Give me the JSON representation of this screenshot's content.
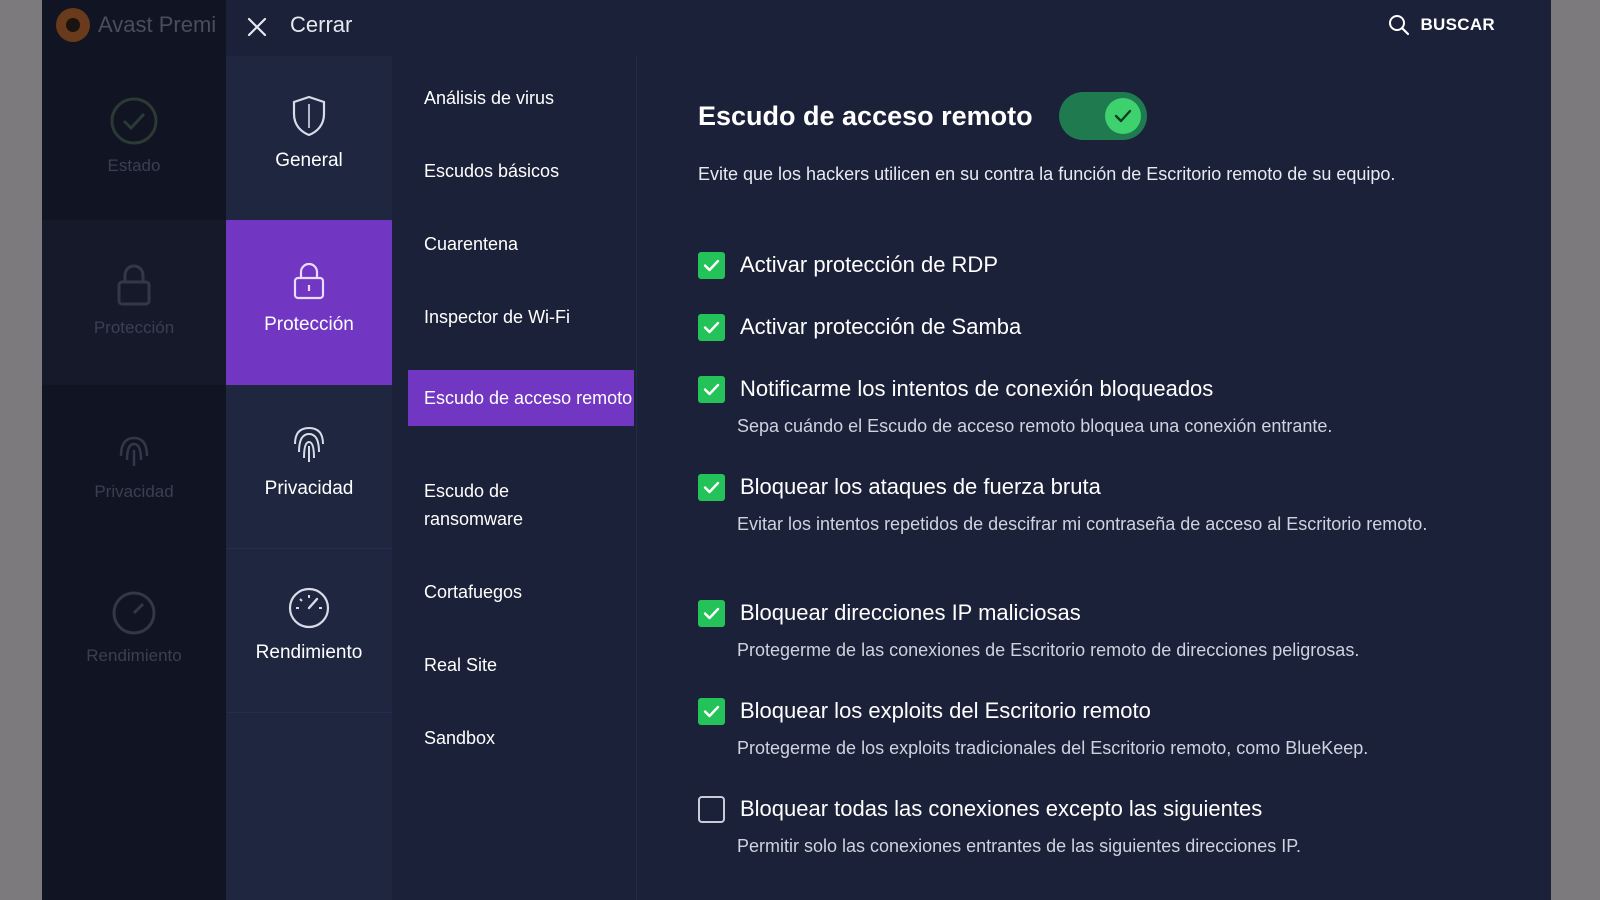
{
  "background_app": {
    "title": "Avast Premi",
    "nav": [
      "Estado",
      "Protección",
      "Privacidad",
      "Rendimiento"
    ]
  },
  "topbar": {
    "close_label": "Cerrar",
    "search_label": "BUSCAR"
  },
  "categories": [
    {
      "label": "General",
      "icon": "shield-icon",
      "active": false
    },
    {
      "label": "Protección",
      "icon": "lock-icon",
      "active": true
    },
    {
      "label": "Privacidad",
      "icon": "fingerprint-icon",
      "active": false
    },
    {
      "label": "Rendimiento",
      "icon": "speedometer-icon",
      "active": false
    }
  ],
  "subnav": [
    {
      "label": "Análisis de virus",
      "active": false
    },
    {
      "label": "Escudos básicos",
      "active": false
    },
    {
      "label": "Cuarentena",
      "active": false
    },
    {
      "label": "Inspector de Wi-Fi",
      "active": false
    },
    {
      "label": "Escudo de acceso remoto",
      "active": true
    },
    {
      "label": "Escudo de ransomware",
      "active": false
    },
    {
      "label": "Cortafuegos",
      "active": false
    },
    {
      "label": "Real Site",
      "active": false
    },
    {
      "label": "Sandbox",
      "active": false
    }
  ],
  "content": {
    "title": "Escudo de acceso remoto",
    "toggle_on": true,
    "description": "Evite que los hackers utilicen en su contra la función de Escritorio remoto de su equipo.",
    "options": [
      {
        "label": "Activar protección de RDP",
        "checked": true,
        "sub": ""
      },
      {
        "label": "Activar protección de Samba",
        "checked": true,
        "sub": ""
      },
      {
        "label": "Notificarme los intentos de conexión bloqueados",
        "checked": true,
        "sub": "Sepa cuándo el Escudo de acceso remoto bloquea una conexión entrante."
      },
      {
        "label": "Bloquear los ataques de fuerza bruta",
        "checked": true,
        "sub": "Evitar los intentos repetidos de descifrar mi contraseña de acceso al Escritorio remoto."
      },
      {
        "label": "Bloquear direcciones IP maliciosas",
        "checked": true,
        "sub": "Protegerme de las conexiones de Escritorio remoto de direcciones peligrosas."
      },
      {
        "label": "Bloquear los exploits del Escritorio remoto",
        "checked": true,
        "sub": "Protegerme de los exploits tradicionales del Escritorio remoto, como BlueKeep."
      },
      {
        "label": "Bloquear todas las conexiones excepto las siguientes",
        "checked": false,
        "sub": "Permitir solo las conexiones entrantes de las siguientes direcciones IP."
      }
    ]
  },
  "colors": {
    "accent": "#7136c2",
    "check_green": "#23c35a",
    "toggle_track": "#1f7a50",
    "panel_bg": "#1b2138"
  }
}
